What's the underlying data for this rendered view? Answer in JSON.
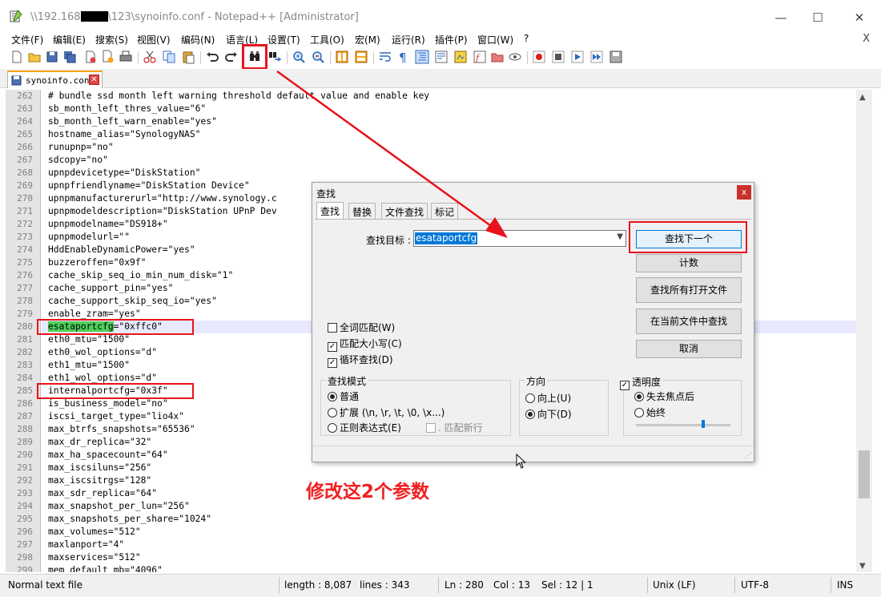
{
  "window": {
    "title_prefix": "\\\\192.168",
    "title_suffix": "\\123\\synoinfo.conf - Notepad++ [Administrator]",
    "minimize": "—",
    "maximize": "☐",
    "close": "✕"
  },
  "menu": {
    "items": [
      "文件(F)",
      "编辑(E)",
      "搜索(S)",
      "视图(V)",
      "编码(N)",
      "语言(L)",
      "设置(T)",
      "工具(O)",
      "宏(M)",
      "运行(R)",
      "插件(P)",
      "窗口(W)",
      "?"
    ],
    "close": "X"
  },
  "toolbar": {
    "icons": [
      "new-file-icon",
      "open-file-icon",
      "save-icon",
      "save-all-icon",
      "close-icon",
      "close-all-icon",
      "print-icon",
      "cut-icon",
      "copy-icon",
      "paste-icon",
      "undo-icon",
      "redo-icon",
      "find-icon",
      "replace-icon",
      "zoom-in-icon",
      "zoom-out-icon",
      "sync-v-icon",
      "sync-h-icon",
      "word-wrap-icon",
      "show-all-icon",
      "indent-guide-icon",
      "udl-icon",
      "doc-map-icon",
      "function-list-icon",
      "folder-workspace-icon",
      "monitor-icon",
      "record-macro-icon",
      "stop-macro-icon",
      "play-macro-icon",
      "run-macro-icon",
      "save-macro-icon"
    ]
  },
  "tab": {
    "label": "synoinfo.conf",
    "close": "✕"
  },
  "editor": {
    "lines": [
      {
        "n": "262",
        "text": "# bundle ssd month left warning threshold default value and enable key"
      },
      {
        "n": "263",
        "text": "sb_month_left_thres_value=\"6\""
      },
      {
        "n": "264",
        "text": "sb_month_left_warn_enable=\"yes\""
      },
      {
        "n": "265",
        "text": "hostname_alias=\"SynologyNAS\""
      },
      {
        "n": "266",
        "text": "runupnp=\"no\""
      },
      {
        "n": "267",
        "text": "sdcopy=\"no\""
      },
      {
        "n": "268",
        "text": "upnpdevicetype=\"DiskStation\""
      },
      {
        "n": "269",
        "text": "upnpfriendlyname=\"DiskStation Device\""
      },
      {
        "n": "270",
        "text": "upnpmanufacturerurl=\"http://www.synology.c"
      },
      {
        "n": "271",
        "text": "upnpmodeldescription=\"DiskStation UPnP Dev"
      },
      {
        "n": "272",
        "text": "upnpmodelname=\"DS918+\""
      },
      {
        "n": "273",
        "text": "upnpmodelurl=\"\""
      },
      {
        "n": "274",
        "text": "HddEnableDynamicPower=\"yes\""
      },
      {
        "n": "275",
        "text": "buzzeroffen=\"0x9f\""
      },
      {
        "n": "276",
        "text": "cache_skip_seq_io_min_num_disk=\"1\""
      },
      {
        "n": "277",
        "text": "cache_support_pin=\"yes\""
      },
      {
        "n": "278",
        "text": "cache_support_skip_seq_io=\"yes\""
      },
      {
        "n": "279",
        "text": "enable_zram=\"yes\""
      },
      {
        "n": "280",
        "text": "=\"0xffc0\"",
        "match": "esataportcfg"
      },
      {
        "n": "281",
        "text": "eth0_mtu=\"1500\""
      },
      {
        "n": "282",
        "text": "eth0_wol_options=\"d\""
      },
      {
        "n": "283",
        "text": "eth1_mtu=\"1500\""
      },
      {
        "n": "284",
        "text": "eth1_wol_options=\"d\""
      },
      {
        "n": "285",
        "text": "internalportcfg=\"0x3f\""
      },
      {
        "n": "286",
        "text": "is_business_model=\"no\""
      },
      {
        "n": "287",
        "text": "iscsi_target_type=\"lio4x\""
      },
      {
        "n": "288",
        "text": "max_btrfs_snapshots=\"65536\""
      },
      {
        "n": "289",
        "text": "max_dr_replica=\"32\""
      },
      {
        "n": "290",
        "text": "max_ha_spacecount=\"64\""
      },
      {
        "n": "291",
        "text": "max_iscsiluns=\"256\""
      },
      {
        "n": "292",
        "text": "max_iscsitrgs=\"128\""
      },
      {
        "n": "293",
        "text": "max_sdr_replica=\"64\""
      },
      {
        "n": "294",
        "text": "max_snapshot_per_lun=\"256\""
      },
      {
        "n": "295",
        "text": "max_snapshots_per_share=\"1024\""
      },
      {
        "n": "296",
        "text": "max_volumes=\"512\""
      },
      {
        "n": "297",
        "text": "maxlanport=\"4\""
      },
      {
        "n": "298",
        "text": "maxservices=\"512\""
      },
      {
        "n": "299",
        "text": "mem_default_mb=\"4096\""
      }
    ]
  },
  "statusbar": {
    "file_type": "Normal text file",
    "length": "length : 8,087",
    "lines": "lines : 343",
    "ln": "Ln : 280",
    "col": "Col : 13",
    "sel": "Sel : 12 | 1",
    "eol": "Unix (LF)",
    "encoding": "UTF-8",
    "mode": "INS"
  },
  "find_dialog": {
    "title": "查找",
    "close": "x",
    "tabs": [
      "查找",
      "替换",
      "文件查找",
      "标记"
    ],
    "find_label": "查找目标 :",
    "find_value": "esataportcfg",
    "buttons": {
      "find_next": "查找下一个",
      "count": "计数",
      "find_all_open": "查找所有打开文件",
      "find_in_current": "在当前文件中查找",
      "cancel": "取消"
    },
    "options": {
      "whole_word": "全词匹配(W)",
      "match_case": "匹配大小写(C)",
      "wrap_around": "循环查找(D)"
    },
    "search_mode": {
      "title": "查找模式",
      "normal": "普通",
      "extended": "扩展 (\\n, \\r, \\t, \\0, \\x...)",
      "regex": "正则表达式(E)",
      "dot_newline": ". 匹配新行"
    },
    "direction": {
      "title": "方向",
      "up": "向上(U)",
      "down": "向下(D)"
    },
    "transparency": {
      "title": "透明度",
      "on_lose_focus": "失去焦点后",
      "always": "始终",
      "level": 0.72
    }
  },
  "annotation": "修改这2个参数",
  "colors": {
    "highlight_red": "#e8131b",
    "match_green": "#4dd05a",
    "annotation_red": "#f02020",
    "selection_blue": "#0078d7"
  }
}
